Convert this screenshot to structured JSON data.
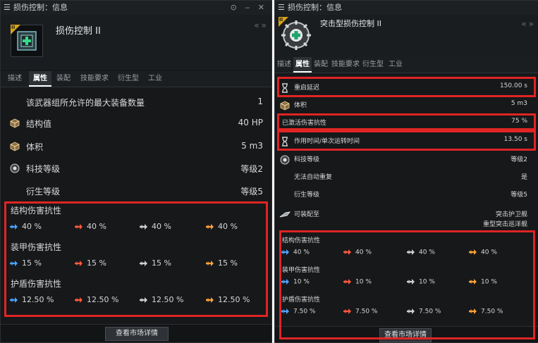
{
  "left": {
    "window_title": "损伤控制：信息",
    "item_name": "损伤控制 II",
    "meta_level": "II",
    "tabs": [
      "描述",
      "属性",
      "装配",
      "技能要求",
      "衍生型",
      "工业"
    ],
    "active_tab": 1,
    "attributes": [
      {
        "label": "该武器组所允许的最大装备数量",
        "value": "1",
        "icon": "none"
      },
      {
        "label": "结构值",
        "value": "40 HP",
        "icon": "cube-icon"
      },
      {
        "label": "体积",
        "value": "5 m3",
        "icon": "cube-icon"
      },
      {
        "label": "科技等级",
        "value": "等级2",
        "icon": "tech-level-icon"
      },
      {
        "label": "衍生等级",
        "value": "等级5",
        "icon": "none"
      }
    ],
    "resist_sections": [
      {
        "title": "结构伤害抗性",
        "values": [
          "40 %",
          "40 %",
          "40 %",
          "40 %"
        ]
      },
      {
        "title": "装甲伤害抗性",
        "values": [
          "15 %",
          "15 %",
          "15 %",
          "15 %"
        ]
      },
      {
        "title": "护盾伤害抗性",
        "values": [
          "12.50 %",
          "12.50 %",
          "12.50 %",
          "12.50 %"
        ]
      }
    ],
    "market_button": "查看市场详情"
  },
  "right": {
    "window_title": "损伤控制：信息",
    "item_name": "突击型损伤控制 II",
    "meta_level": "II",
    "tabs": [
      "描述",
      "属性",
      "装配",
      "技能要求",
      "衍生型",
      "工业"
    ],
    "active_tab": 1,
    "attributes": [
      {
        "label": "重启延迟",
        "value": "150.00 s",
        "icon": "hourglass-icon"
      },
      {
        "label": "体积",
        "value": "5 m3",
        "icon": "cube-icon"
      },
      {
        "label": "已激活伤害抗性",
        "value": "75 %",
        "icon": "none"
      },
      {
        "label": "作用时间/单次运转时间",
        "value": "13.50 s",
        "icon": "hourglass-icon"
      },
      {
        "label": "科技等级",
        "value": "等级2",
        "icon": "tech-level-icon"
      },
      {
        "label": "无法自动重复",
        "value": "是",
        "icon": "none"
      },
      {
        "label": "衍生等级",
        "value": "等级5",
        "icon": "none"
      },
      {
        "label": "可装配至",
        "value": "突击护卫舰",
        "value2": "重型突击巡洋舰",
        "icon": "ship-icon"
      }
    ],
    "resist_sections": [
      {
        "title": "结构伤害抗性",
        "values": [
          "40 %",
          "40 %",
          "40 %",
          "40 %"
        ]
      },
      {
        "title": "装甲伤害抗性",
        "values": [
          "10 %",
          "10 %",
          "10 %",
          "10 %"
        ]
      },
      {
        "title": "护盾伤害抗性",
        "values": [
          "7.50 %",
          "7.50 %",
          "7.50 %",
          "7.50 %"
        ]
      }
    ],
    "market_button": "查看市场详情"
  },
  "damage_type_icons": [
    "em-damage-icon",
    "thermal-damage-icon",
    "kinetic-damage-icon",
    "explosive-damage-icon"
  ],
  "colors": {
    "highlight": "#e02424",
    "meta_badge": "#d9a418",
    "em": "#4aa3ff",
    "thermal": "#ff5a3c",
    "kinetic": "#d0d0d0",
    "explosive": "#ffa23a"
  }
}
